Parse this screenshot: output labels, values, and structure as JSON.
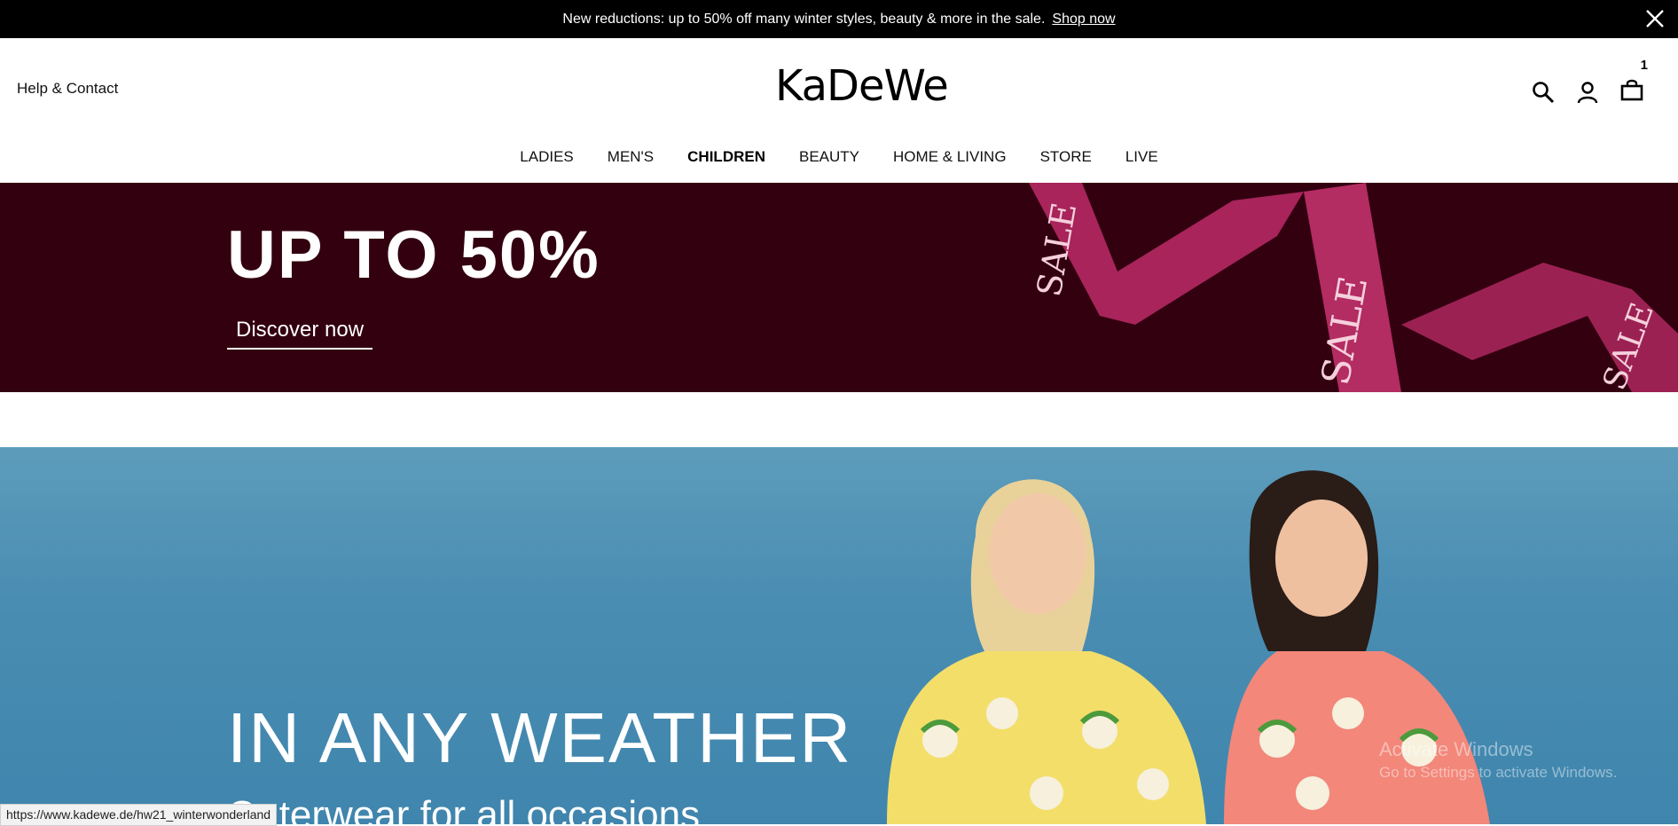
{
  "promo": {
    "text": "New reductions: up to 50% off many winter styles, beauty & more in the sale.",
    "link": "Shop now",
    "close_icon": "close-icon"
  },
  "header": {
    "help": "Help & Contact",
    "logo": "KaDeWe",
    "cart_count": "1",
    "icons": [
      "search-icon",
      "account-icon",
      "bag-icon"
    ]
  },
  "nav": {
    "items": [
      "LADIES",
      "MEN'S",
      "CHILDREN",
      "BEAUTY",
      "HOME & LIVING",
      "STORE",
      "LIVE"
    ],
    "active": "CHILDREN"
  },
  "sale_banner": {
    "headline": "UP TO 50%",
    "cta": "Discover now",
    "ribbon_text": "SALE SALE SALE",
    "background": "#330010",
    "ribbon_color": "#a8245a"
  },
  "hero": {
    "headline": "IN ANY WEATHER",
    "subline": "Outerwear for all occasions",
    "background": "#4a8db2"
  },
  "watermark": {
    "title": "Activate Windows",
    "text": "Go to Settings to activate Windows."
  },
  "status_bar": {
    "url": "https://www.kadewe.de/hw21_winterwonderland"
  }
}
